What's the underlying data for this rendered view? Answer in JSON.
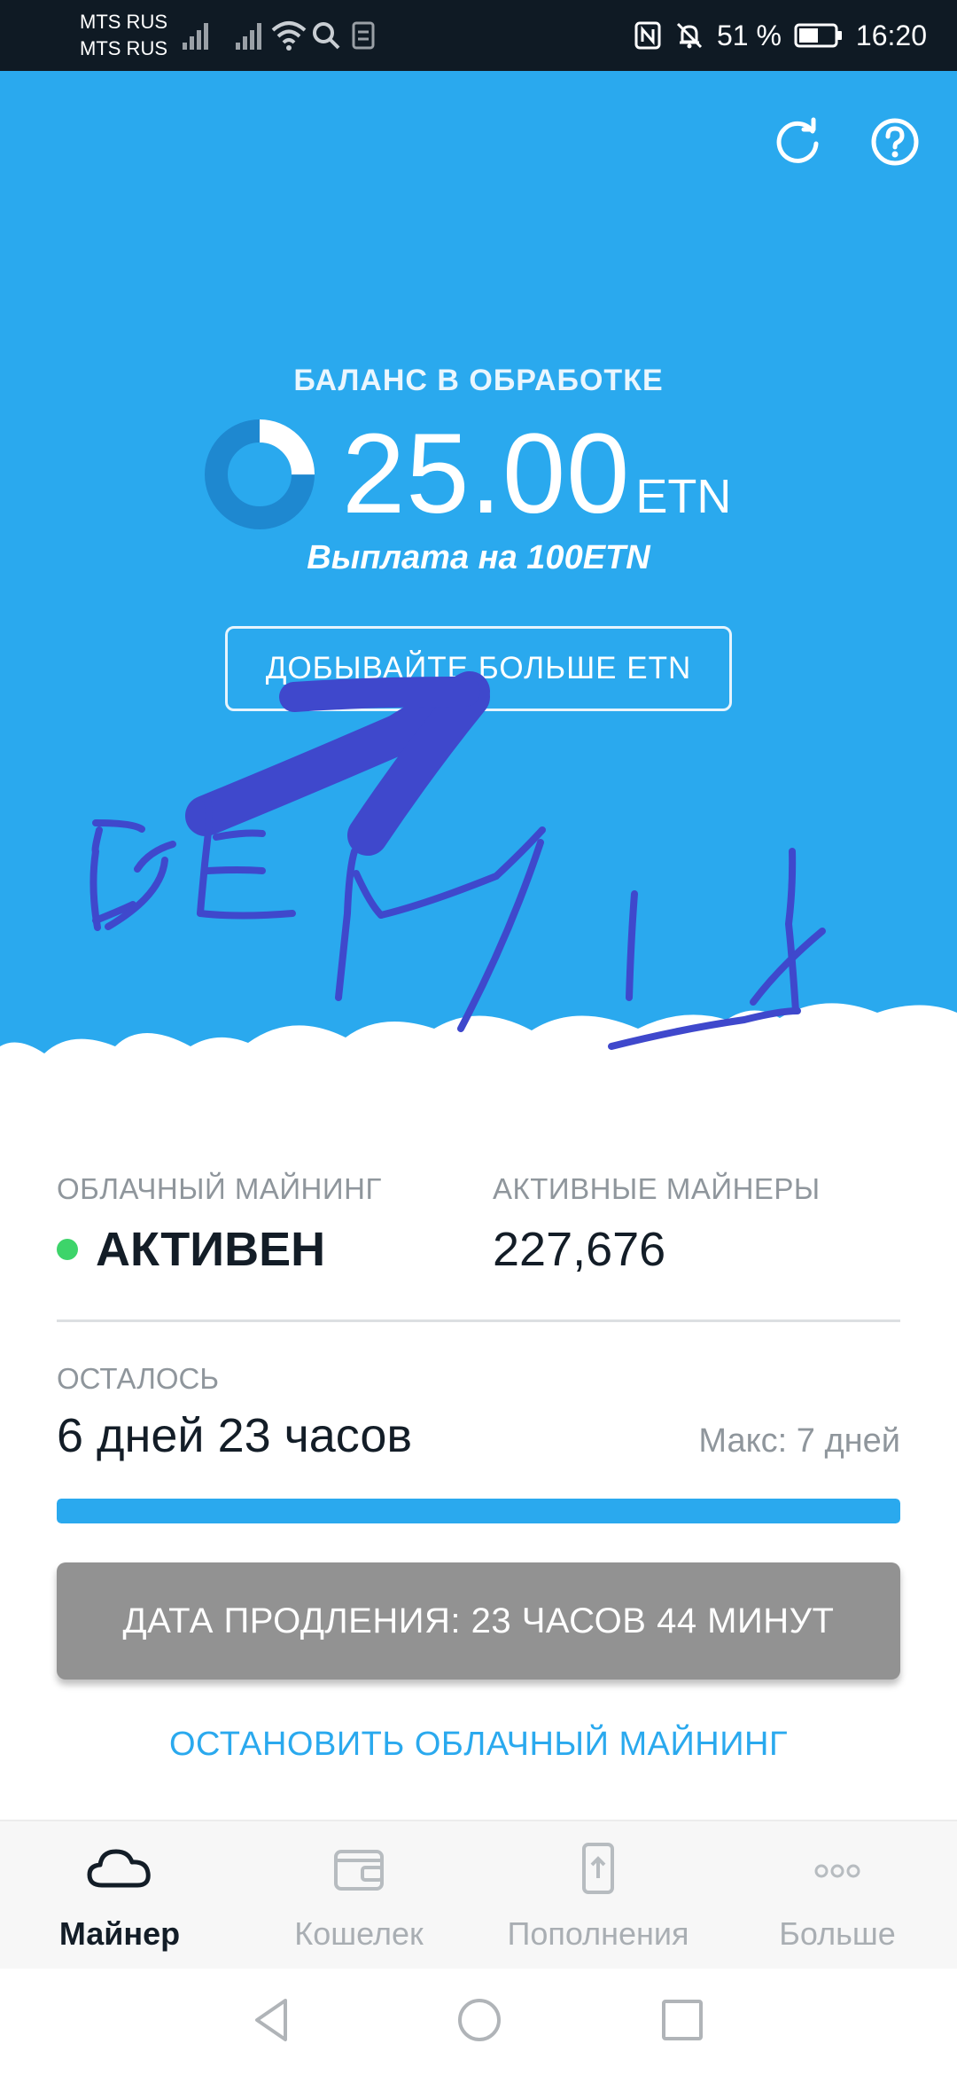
{
  "status_bar": {
    "carrier1": "MTS RUS",
    "carrier2": "MTS RUS",
    "battery": "51 %",
    "time": "16:20"
  },
  "header": {
    "refresh_icon": "refresh-icon",
    "help_icon": "help-icon"
  },
  "balance": {
    "label": "БАЛАНС В ОБРАБОТКЕ",
    "amount": "25.00",
    "unit": "ETN",
    "payout": "Выплата на 100ETN",
    "progress_fraction": 0.25
  },
  "mine_more_label": "ДОБЫВАЙТЕ БОЛЬШЕ ETN",
  "stats": {
    "cloud_mining_label": "ОБЛАЧНЫЙ МАЙНИНГ",
    "cloud_mining_value": "АКТИВЕН",
    "active_miners_label": "АКТИВНЫЕ МАЙНЕРЫ",
    "active_miners_value": "227,676"
  },
  "remaining": {
    "label": "ОСТАЛОСЬ",
    "value": "6 дней 23 часов",
    "max": "Макс: 7 дней",
    "progress_fraction": 1.0
  },
  "renew_button": "ДАТА ПРОДЛЕНИЯ: 23 ЧАСОВ 44 МИНУТ",
  "stop_link": "ОСТАНОВИТЬ ОБЛАЧНЫЙ МАЙНИНГ",
  "nav": {
    "items": [
      {
        "label": "Майнер",
        "icon": "cloud-icon",
        "active": true
      },
      {
        "label": "Кошелек",
        "icon": "wallet-icon",
        "active": false
      },
      {
        "label": "Пополнения",
        "icon": "upload-icon",
        "active": false
      },
      {
        "label": "Больше",
        "icon": "more-icon",
        "active": false
      }
    ]
  },
  "colors": {
    "hero": "#2aa9ee",
    "status_active": "#3dd46a",
    "scribble": "#3f48cc",
    "renew_button": "#929292"
  }
}
